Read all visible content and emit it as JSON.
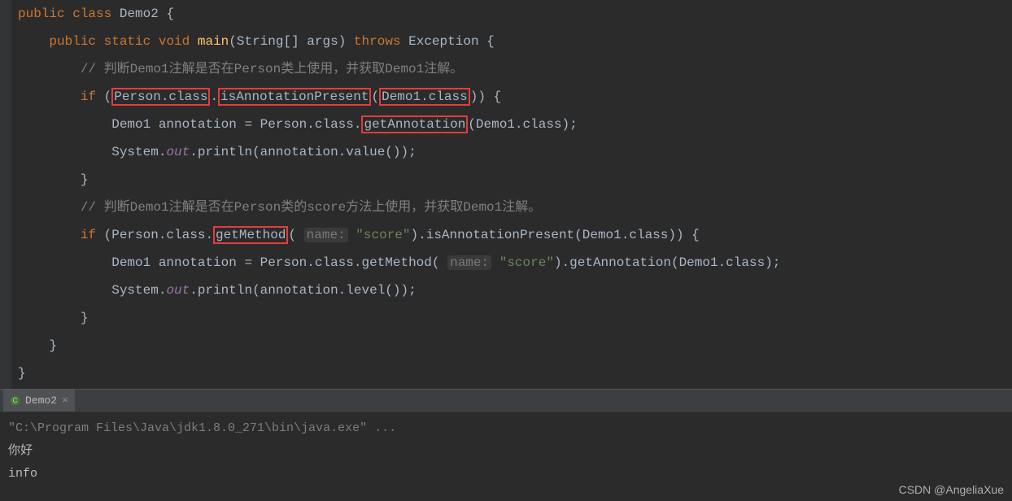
{
  "code": {
    "l1_public": "public",
    "l1_class": "class",
    "l1_name": "Demo2",
    "l2_public": "public",
    "l2_static": "static",
    "l2_void": "void",
    "l2_main": "main",
    "l2_args": "(String[] args)",
    "l2_throws": "throws",
    "l2_exc": "Exception",
    "l3_comment": "// 判断Demo1注解是否在Person类上使用，并获取Demo1注解。",
    "l4_if": "if",
    "l4_person_class": "Person.class",
    "l4_isap": "isAnnotationPresent",
    "l4_demo1": "Demo1.class",
    "l5_body": "Demo1 annotation = Person.class.",
    "l5_getann": "getAnnotation",
    "l5_rest": "(Demo1.class);",
    "l6_sys": "System.",
    "l6_out": "out",
    "l6_println": ".println(annotation.value());",
    "l8_comment": "// 判断Demo1注解是否在Person类的score方法上使用，并获取Demo1注解。",
    "l9_if": "if",
    "l9_pre": " (Person.class.",
    "l9_getmethod": "getMethod",
    "l9_hint": "name:",
    "l9_score": "\"score\"",
    "l9_rest": ").isAnnotationPresent(Demo1.class)) {",
    "l10_body": "Demo1 annotation = Person.class.getMethod(",
    "l10_hint": "name:",
    "l10_score": "\"score\"",
    "l10_rest": ").getAnnotation(Demo1.class);",
    "l11_sys": "System.",
    "l11_out": "out",
    "l11_println": ".println(annotation.level());"
  },
  "tab": {
    "label": "Demo2"
  },
  "console": {
    "command": "\"C:\\Program Files\\Java\\jdk1.8.0_271\\bin\\java.exe\" ...",
    "out1": "你好",
    "out2": "info"
  },
  "watermark": "CSDN @AngeliaXue"
}
